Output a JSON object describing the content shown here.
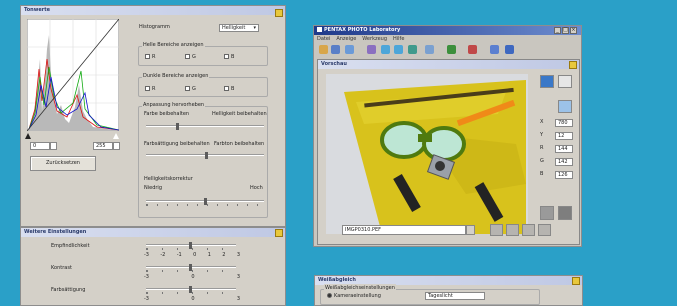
{
  "colors": {
    "background": "#2aa0c8",
    "panel": "#d4d0c8",
    "title_gradient": "#bfc8e4",
    "app_title": "#1f3a8a",
    "photo_board": "#d8c21c"
  },
  "levels": {
    "title": "Tonwerte",
    "histogram_label": "Histogramm",
    "histogram_channel": "Helligkeit",
    "light_section": "Helle Bereiche anzeigen",
    "dark_section": "Dunkle Bereiche anzeigen",
    "channels": [
      "R",
      "G",
      "B"
    ],
    "input_low": "0",
    "input_high": "255",
    "reset_button": "Zurücksetzen",
    "adjust_section": "Anpassung hervorheben",
    "keep_color": "Farbe beibehalten",
    "keep_brightness": "Helligkeit beibehalten",
    "keep_saturation": "Farbsättigung beibehalten",
    "keep_hue": "Farbton beibehalten",
    "brightness_curve": "Helligkeitskorrektur",
    "low": "Niedrig",
    "high": "Hoch"
  },
  "enhance": {
    "title": "Weitere Einstellungen",
    "rows": [
      {
        "label": "Empfindlichkeit",
        "scale": [
          "-3",
          "-2",
          "-1",
          "0",
          "1",
          "2",
          "3"
        ]
      },
      {
        "label": "Kontrast",
        "scale": [
          "-3",
          "",
          "",
          "0",
          "",
          "",
          "3"
        ]
      },
      {
        "label": "Farbsättigung",
        "scale": [
          "-3",
          "",
          "",
          "0",
          "",
          "",
          "3"
        ]
      }
    ]
  },
  "app": {
    "title": "PENTAX PHOTO Laboratory",
    "menu": [
      "Datei",
      "Anzeige",
      "Werkzeug",
      "Hilfe"
    ],
    "preview_title": "Vorschau",
    "filename": "IMGP0310.PEF",
    "pixel_readout": [
      {
        "label": "X",
        "value": "780"
      },
      {
        "label": "Y",
        "value": "12"
      },
      {
        "label": "R",
        "value": "144"
      },
      {
        "label": "G",
        "value": "142"
      },
      {
        "label": "B",
        "value": "126"
      }
    ],
    "win_buttons": [
      "_",
      "□",
      "×"
    ]
  },
  "wb": {
    "title": "Weißabgleich",
    "section": "Weißabgleichseinstellungen",
    "option": "Kameraeinstellung",
    "value": "Tageslicht"
  }
}
